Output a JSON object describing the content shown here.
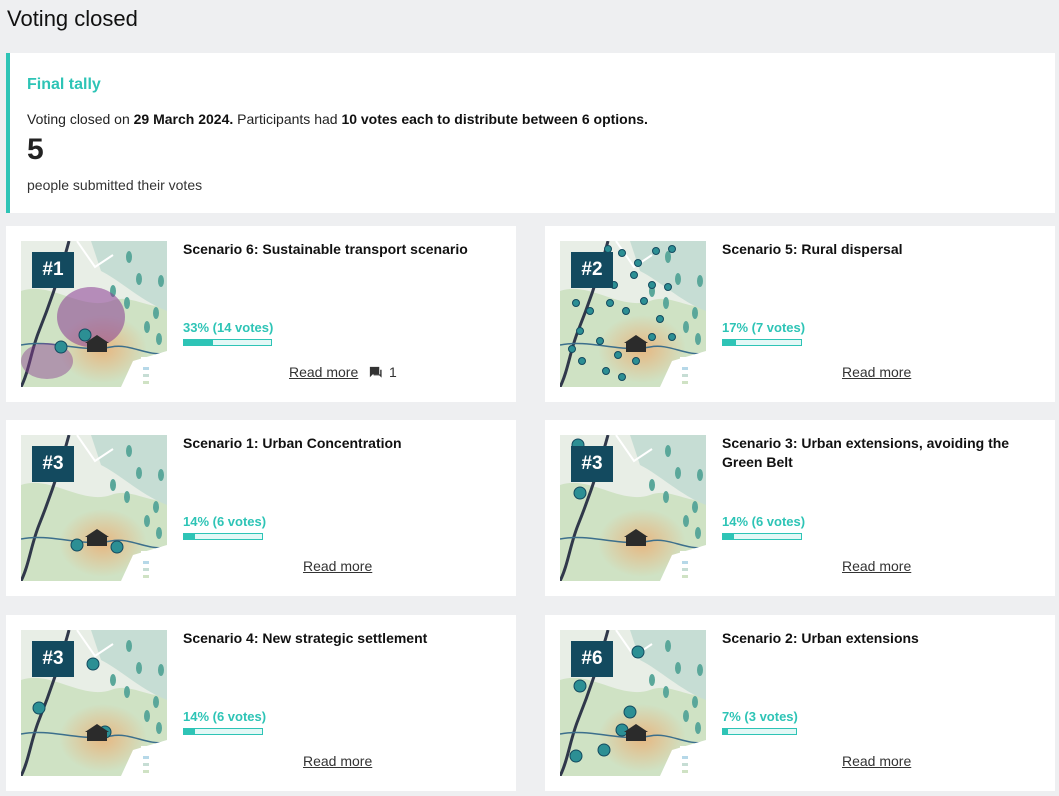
{
  "page": {
    "title": "Voting closed"
  },
  "tally": {
    "title": "Final tally",
    "text_prefix": "Voting closed on ",
    "date": "29 March 2024.",
    "text_middle": " Participants had ",
    "votes_rule": "10 votes each to distribute between 6 options.",
    "count": "5",
    "caption": "people submitted their votes"
  },
  "colors": {
    "accent": "#2ec4b6",
    "rank_bg": "#134a5f"
  },
  "cards": [
    {
      "rank": "#1",
      "title": "Scenario 6: Sustainable transport scenario",
      "percent_label": "33% (14 votes)",
      "percent": 33,
      "bar_fill": 0.33,
      "read_more": "Read more",
      "comments": "1",
      "icon": "scenario-map"
    },
    {
      "rank": "#2",
      "title": "Scenario 5: Rural dispersal",
      "percent_label": "17% (7 votes)",
      "percent": 17,
      "bar_fill": 0.17,
      "read_more": "Read more",
      "icon": "scenario-map"
    },
    {
      "rank": "#3",
      "title": "Scenario 1: Urban Concentration",
      "percent_label": "14% (6 votes)",
      "percent": 14,
      "bar_fill": 0.14,
      "read_more": "Read more",
      "icon": "scenario-map"
    },
    {
      "rank": "#3",
      "title": "Scenario 3: Urban extensions, avoiding the Green Belt",
      "percent_label": "14% (6 votes)",
      "percent": 14,
      "bar_fill": 0.14,
      "read_more": "Read more",
      "icon": "scenario-map"
    },
    {
      "rank": "#3",
      "title": "Scenario 4: New strategic settlement",
      "percent_label": "14% (6 votes)",
      "percent": 14,
      "bar_fill": 0.14,
      "read_more": "Read more",
      "icon": "scenario-map"
    },
    {
      "rank": "#6",
      "title": "Scenario 2: Urban extensions",
      "percent_label": "7% (3 votes)",
      "percent": 7,
      "bar_fill": 0.07,
      "read_more": "Read more",
      "icon": "scenario-map"
    }
  ]
}
